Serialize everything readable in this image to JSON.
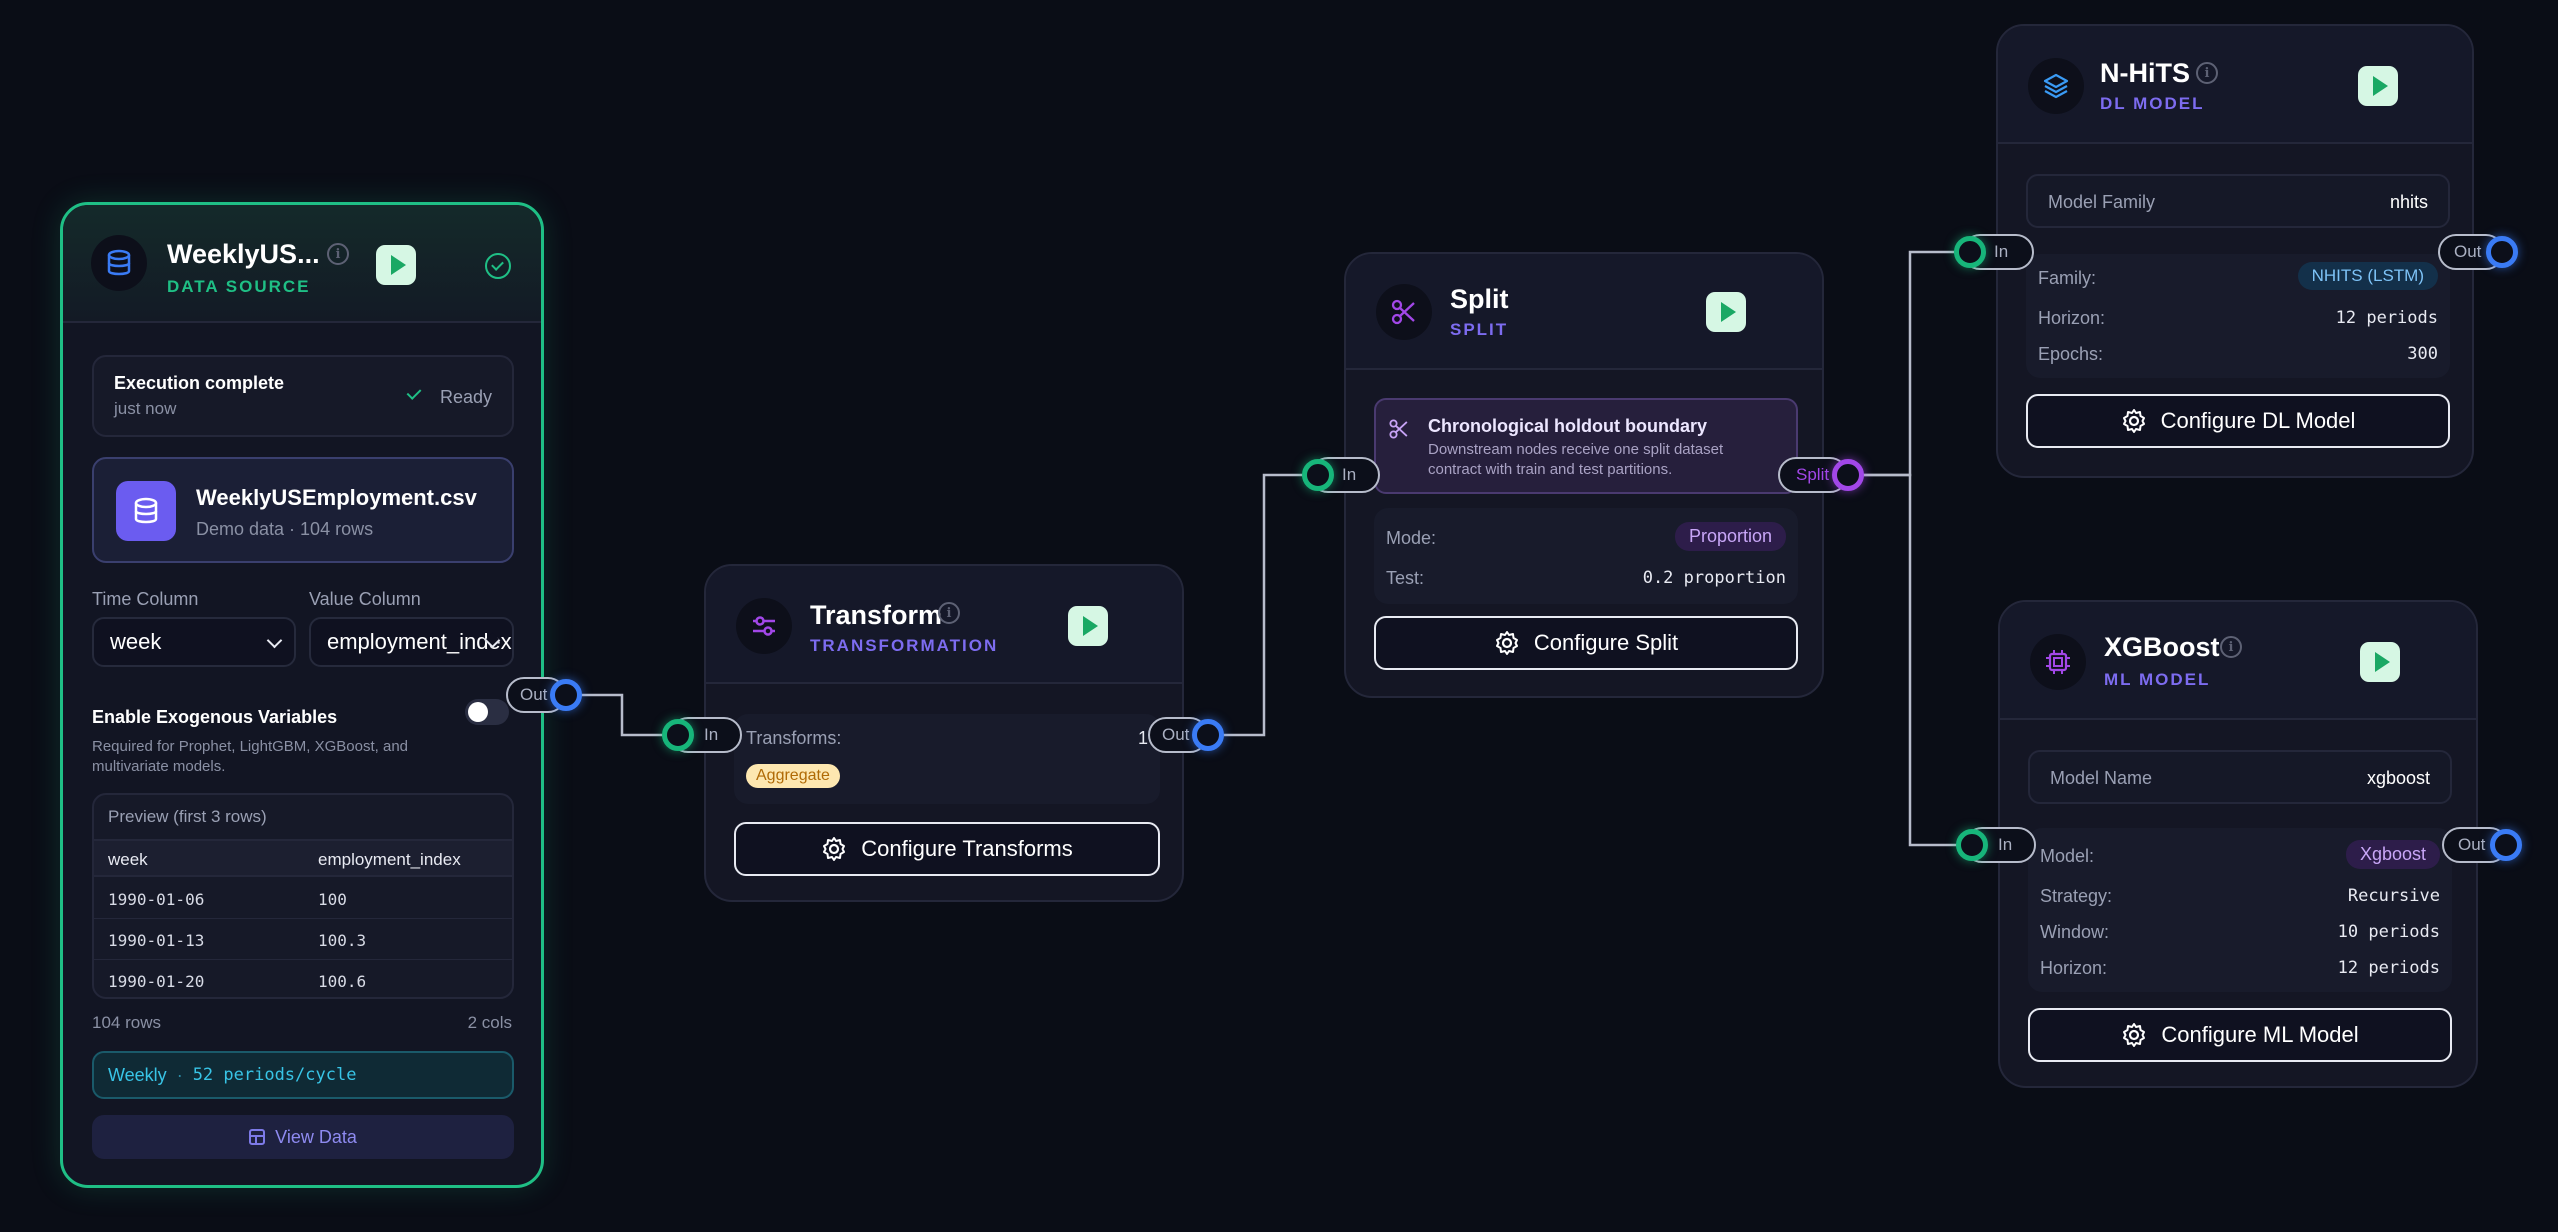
{
  "colors": {
    "accent_green": "#17b57a",
    "accent_blue": "#3a7bf5",
    "accent_purple": "#a247e8",
    "background": "#0a0d16"
  },
  "datasource": {
    "title": "WeeklyUS...",
    "subtitle": "DATA SOURCE",
    "status_title": "Execution complete",
    "status_time": "just now",
    "status_badge": "Ready",
    "file_name": "WeeklyUSEmployment.csv",
    "file_meta": "Demo data · 104 rows",
    "time_column_label": "Time Column",
    "time_column_value": "week",
    "value_column_label": "Value Column",
    "value_column_value": "employment_index",
    "exog_label": "Enable Exogenous Variables",
    "exog_desc": "Required for Prophet, LightGBM, XGBoost, and multivariate models.",
    "exog_enabled": false,
    "preview_title": "Preview (first 3 rows)",
    "columns": [
      "week",
      "employment_index"
    ],
    "rows": [
      [
        "1990-01-06",
        "100"
      ],
      [
        "1990-01-13",
        "100.3"
      ],
      [
        "1990-01-20",
        "100.6"
      ]
    ],
    "row_count": "104 rows",
    "col_count": "2 cols",
    "frequency": "Weekly",
    "frequency_detail": "52 periods/cycle",
    "view_data_label": "View Data",
    "out_port": "Out"
  },
  "transform": {
    "title": "Transform",
    "subtitle": "TRANSFORMATION",
    "transforms_label": "Transforms:",
    "transforms_count": "1",
    "tag": "Aggregate",
    "configure_label": "Configure Transforms",
    "in_port": "In",
    "out_port": "Out"
  },
  "split": {
    "title": "Split",
    "subtitle": "SPLIT",
    "banner_title": "Chronological holdout boundary",
    "banner_desc": "Downstream nodes receive one split dataset contract with train and test partitions.",
    "mode_label": "Mode:",
    "mode_value": "Proportion",
    "test_label": "Test:",
    "test_value": "0.2 proportion",
    "configure_label": "Configure Split",
    "in_port": "In",
    "out_port": "Split"
  },
  "nhits": {
    "title": "N-HiTS",
    "subtitle": "DL MODEL",
    "family_label": "Model Family",
    "family_value": "nhits",
    "family_row_label": "Family:",
    "family_row_value": "NHITS (LSTM)",
    "horizon_label": "Horizon:",
    "horizon_value": "12 periods",
    "epochs_label": "Epochs:",
    "epochs_value": "300",
    "configure_label": "Configure DL Model",
    "in_port": "In",
    "out_port": "Out"
  },
  "xgboost": {
    "title": "XGBoost",
    "subtitle": "ML MODEL",
    "name_label": "Model Name",
    "name_value": "xgboost",
    "model_label": "Model:",
    "model_value": "Xgboost",
    "strategy_label": "Strategy:",
    "strategy_value": "Recursive",
    "window_label": "Window:",
    "window_value": "10 periods",
    "horizon_label": "Horizon:",
    "horizon_value": "12 periods",
    "configure_label": "Configure ML Model",
    "in_port": "In",
    "out_port": "Out"
  }
}
